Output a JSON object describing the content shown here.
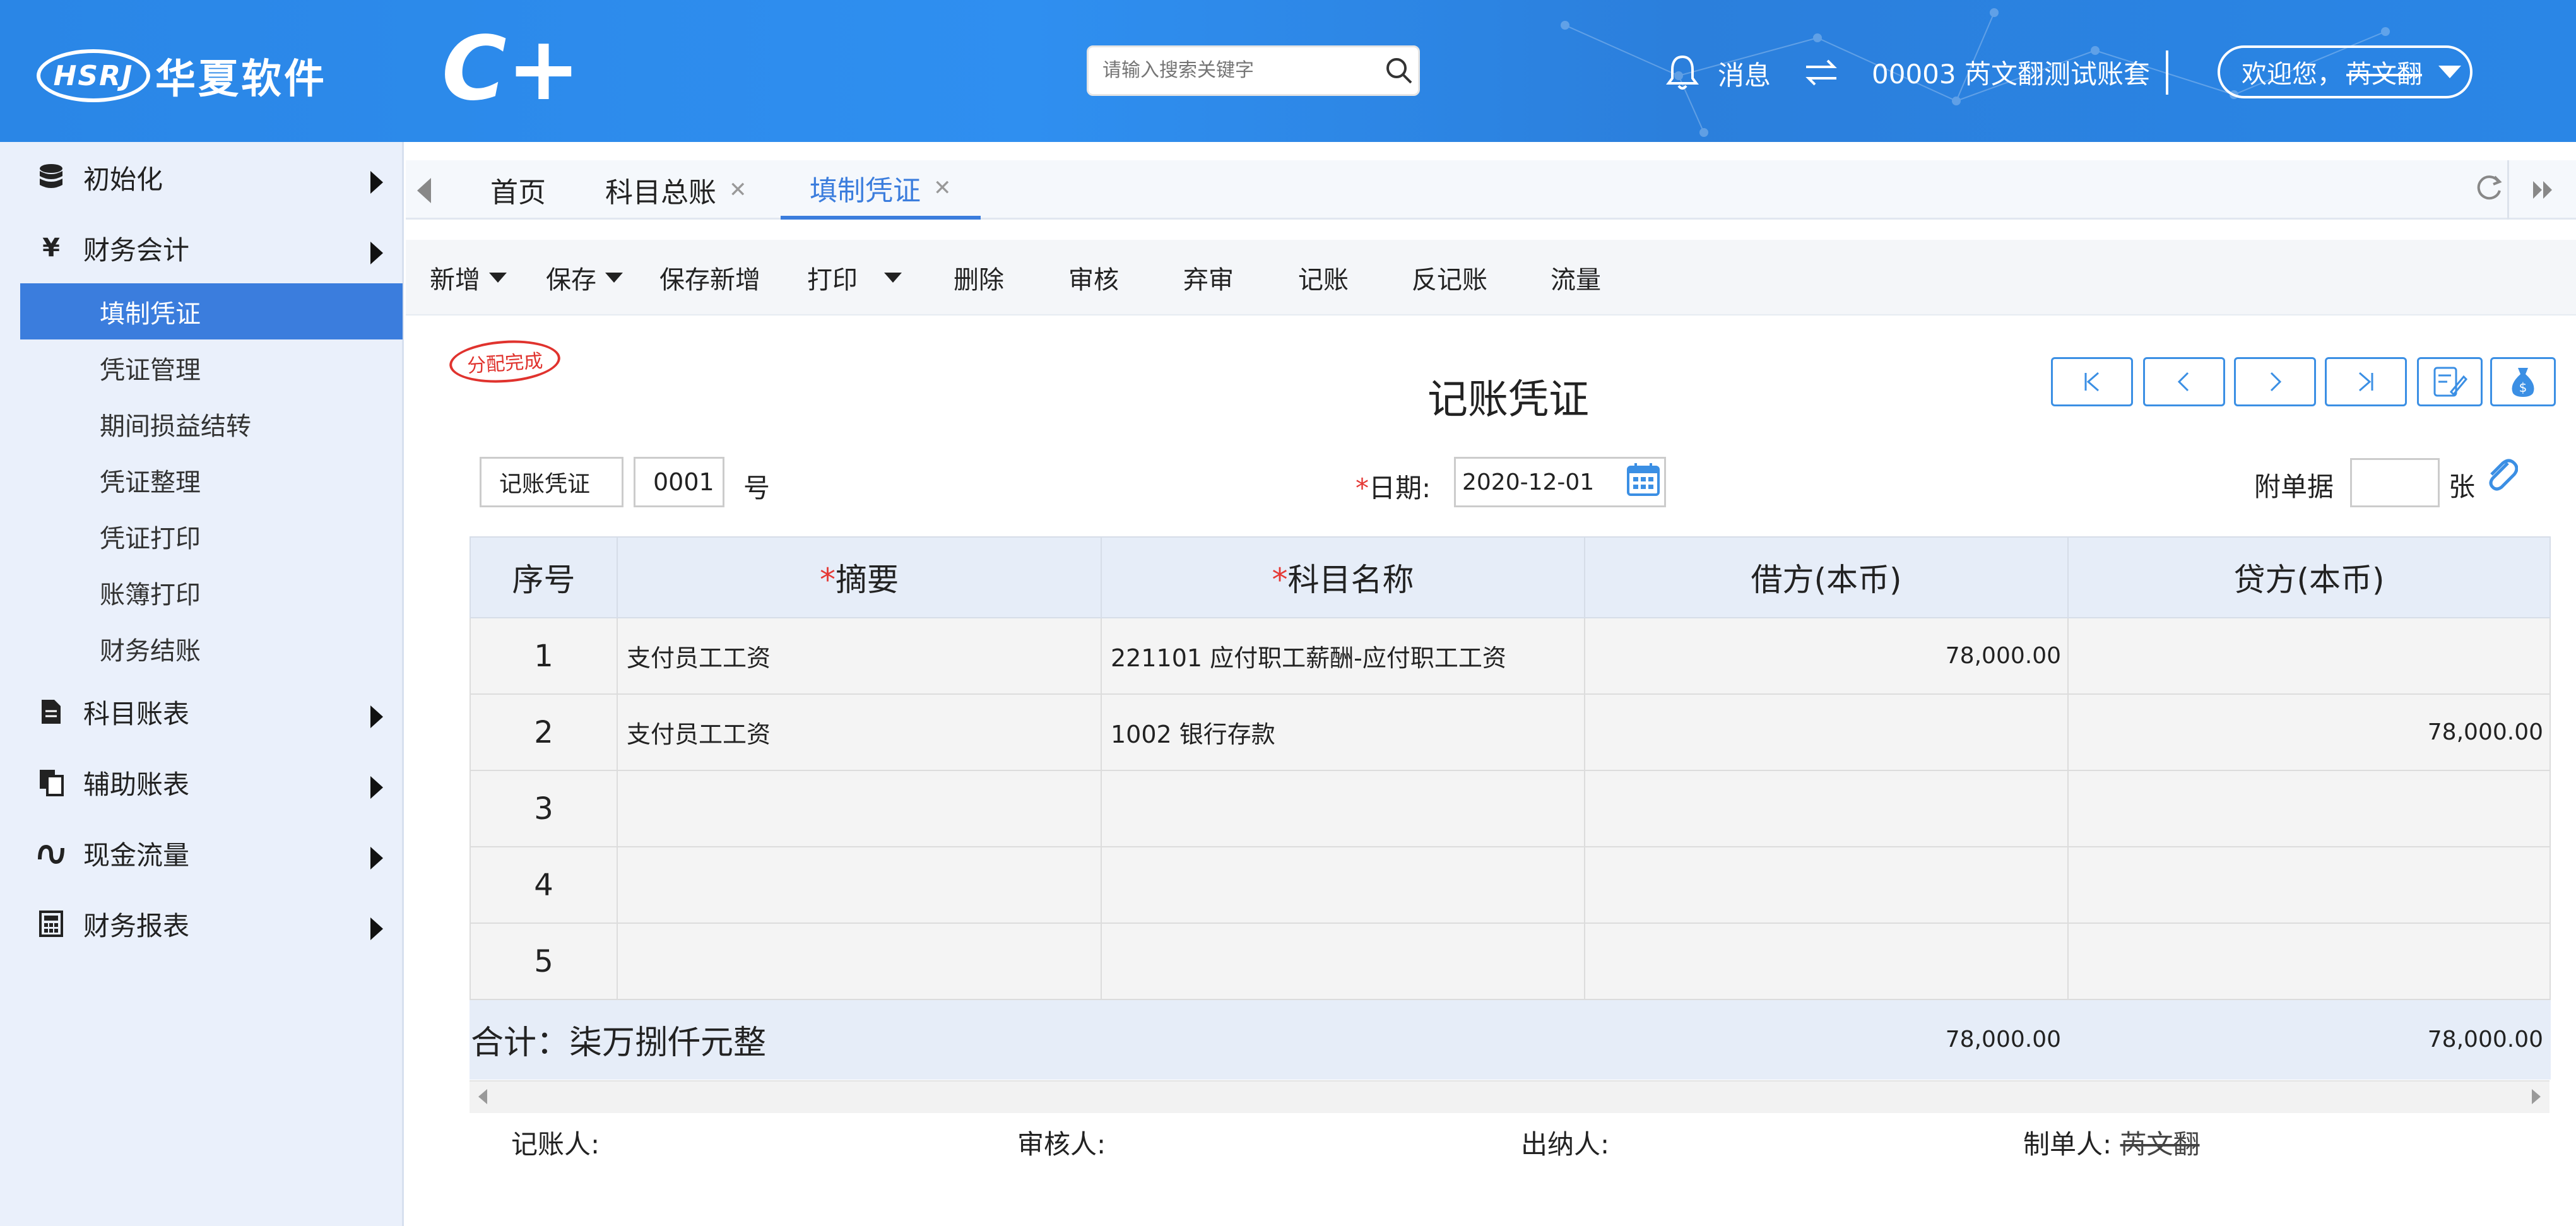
{
  "header": {
    "logo_mark": "HSRJ",
    "logo_name": "华夏软件",
    "product": "C+",
    "search_placeholder": "请输入搜索关键字",
    "messages_label": "消息",
    "account": "00003 芮文翻测试账套",
    "welcome": "欢迎您，",
    "user": "芮文翻"
  },
  "sidebar": {
    "groups": [
      {
        "label": "初始化",
        "icon": "database-icon"
      },
      {
        "label": "财务会计",
        "icon": "yen-icon"
      },
      {
        "label": "科目账表",
        "icon": "document-icon"
      },
      {
        "label": "辅助账表",
        "icon": "copy-icon"
      },
      {
        "label": "现金流量",
        "icon": "flow-icon"
      },
      {
        "label": "财务报表",
        "icon": "calculator-icon"
      }
    ],
    "items": [
      "填制凭证",
      "凭证管理",
      "期间损益结转",
      "凭证整理",
      "凭证打印",
      "账簿打印",
      "财务结账"
    ]
  },
  "tabs": [
    {
      "label": "首页"
    },
    {
      "label": "科目总账"
    },
    {
      "label": "填制凭证"
    }
  ],
  "toolbar": [
    "新增",
    "保存",
    "保存新增",
    "打印",
    "删除",
    "审核",
    "弃审",
    "记账",
    "反记账",
    "流量"
  ],
  "voucher": {
    "stamp": "分配完成",
    "title": "记账凭证",
    "type": "记账凭证",
    "number": "0001",
    "number_suffix": "号",
    "date_label": "日期:",
    "date": "2020-12-01",
    "attach_label": "附单据",
    "attach_value": "",
    "attach_unit": "张"
  },
  "table": {
    "headers": [
      "序号",
      "摘要",
      "科目名称",
      "借方(本币)",
      "贷方(本币)"
    ],
    "rows": [
      {
        "seq": "1",
        "summary": "支付员工工资",
        "account": "221101 应付职工薪酬-应付职工工资",
        "debit": "78,000.00",
        "credit": ""
      },
      {
        "seq": "2",
        "summary": "支付员工工资",
        "account": "1002 银行存款",
        "debit": "",
        "credit": "78,000.00"
      },
      {
        "seq": "3",
        "summary": "",
        "account": "",
        "debit": "",
        "credit": ""
      },
      {
        "seq": "4",
        "summary": "",
        "account": "",
        "debit": "",
        "credit": ""
      },
      {
        "seq": "5",
        "summary": "",
        "account": "",
        "debit": "",
        "credit": ""
      }
    ],
    "total_label": "合计：柒万捌仟元整",
    "total_debit": "78,000.00",
    "total_credit": "78,000.00"
  },
  "signatures": {
    "bookkeeper": "记账人:",
    "auditor": "审核人:",
    "cashier": "出纳人:",
    "preparer": "制单人:",
    "preparer_name": "芮文翻"
  }
}
